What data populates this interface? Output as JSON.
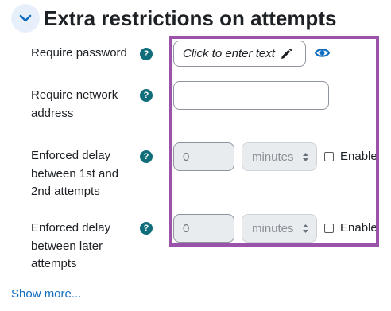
{
  "section": {
    "title": "Extra restrictions on attempts",
    "help_glyph": "?",
    "toggle_icon": "chevron-down-icon"
  },
  "rows": {
    "require_password": {
      "label": "Require password",
      "value_placeholder": "Click to enter text",
      "edit_icon": "pencil-icon",
      "reveal_icon": "eye-icon"
    },
    "require_network": {
      "label_lines": [
        "Require network",
        "address"
      ],
      "value": ""
    },
    "delay_1_2": {
      "label_lines": [
        "Enforced delay",
        "between 1st and",
        "2nd attempts"
      ],
      "value": "0",
      "unit": "minutes",
      "enable_label": "Enable",
      "enabled": false
    },
    "delay_later": {
      "label_lines": [
        "Enforced delay",
        "between later",
        "attempts"
      ],
      "value": "0",
      "unit": "minutes",
      "enable_label": "Enable",
      "enabled": false
    }
  },
  "footer": {
    "show_more": "Show more..."
  },
  "colors": {
    "accent": "#0f6cbf",
    "help_icon": "#0f6e7a",
    "highlight_frame": "#9a53a9",
    "toggle_bg": "#e7f0fa"
  }
}
